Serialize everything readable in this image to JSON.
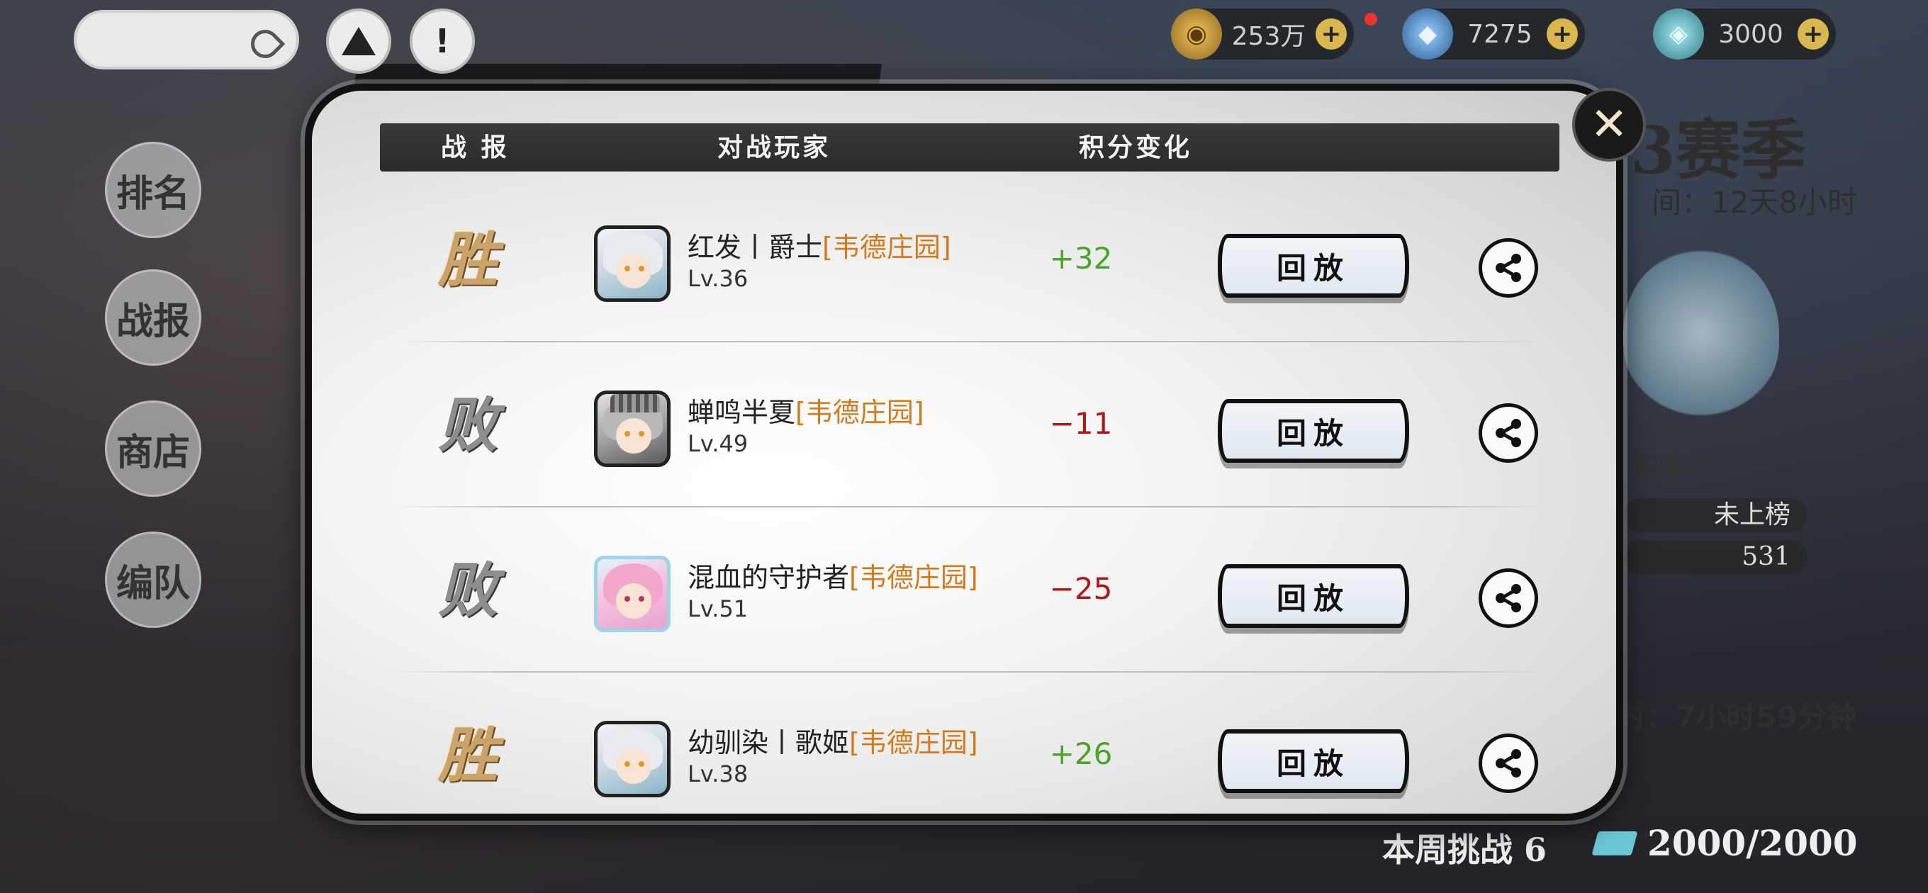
{
  "top_bar": {
    "currencies": [
      {
        "value": "253万",
        "icon": "gold-coin-icon"
      },
      {
        "value": "7275",
        "icon": "crystal-icon"
      },
      {
        "value": "3000",
        "icon": "ticket-gem-icon"
      }
    ],
    "plus_label": "+"
  },
  "side_nav": [
    "排名",
    "战报",
    "商店",
    "编队"
  ],
  "right_panel": {
    "season_title": "3赛季",
    "season_time": "间：12天8小时",
    "rank_name": "铂金II",
    "rank_rows": [
      "未上榜",
      "531"
    ],
    "reset_time": "时：7小时59分钟",
    "bottom_left": "本周挑战 6",
    "bottom_right": "2000/2000"
  },
  "modal": {
    "close_label": "✕",
    "headers": {
      "result": "战 报",
      "player": "对战玩家",
      "score": "积分变化"
    },
    "replay_label": "回放",
    "rows": [
      {
        "result": "胜",
        "result_type": "win",
        "name": "红发丨爵士",
        "guild": "[韦德庄园]",
        "level": "Lv.36",
        "score": "+32",
        "score_type": "pos",
        "avatar": "white-hair"
      },
      {
        "result": "败",
        "result_type": "loss",
        "name": "蝉鸣半夏",
        "guild": "[韦德庄园]",
        "level": "Lv.49",
        "score": "−11",
        "score_type": "neg",
        "avatar": "knight"
      },
      {
        "result": "败",
        "result_type": "loss",
        "name": "混血的守护者",
        "guild": "[韦德庄园]",
        "level": "Lv.51",
        "score": "−25",
        "score_type": "neg",
        "avatar": "pink"
      },
      {
        "result": "胜",
        "result_type": "win",
        "name": "幼驯染丨歌姬",
        "guild": "[韦德庄园]",
        "level": "Lv.38",
        "score": "+26",
        "score_type": "pos",
        "avatar": "white-hair"
      }
    ]
  },
  "colors": {
    "win_score": "#4aa32a",
    "loss_score": "#b01818",
    "guild": "#d27a1c"
  }
}
